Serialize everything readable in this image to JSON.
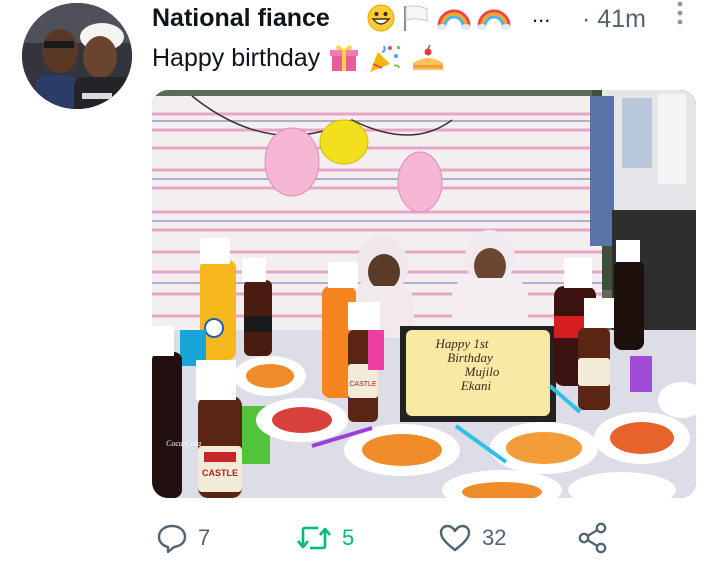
{
  "tweet": {
    "author_name": "National fiance",
    "name_emojis": [
      "grinning-face",
      "white-flag",
      "rainbow",
      "rainbow"
    ],
    "truncation": "...",
    "time": "· 41m",
    "text": "Happy birthday",
    "text_emojis": [
      "wrapped-gift",
      "party-popper",
      "birthday-cake"
    ]
  },
  "photo": {
    "cake_text": [
      "Happy 1st",
      "Birthday",
      "Mujilo",
      "Ekani"
    ],
    "bottle_label": "CASTLE",
    "cola_label": "Coca-Cola"
  },
  "actions": {
    "replies": "7",
    "retweets": "5",
    "likes": "32"
  },
  "colors": {
    "retweet": "#00ba7c",
    "muted": "#536471"
  }
}
